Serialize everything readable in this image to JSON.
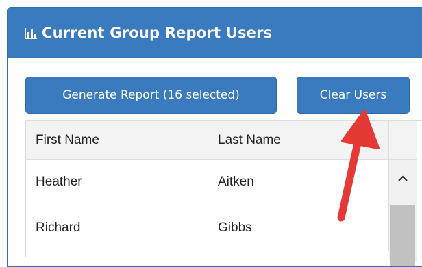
{
  "panel": {
    "title": "Current Group Report Users",
    "icon": "bar-chart-icon"
  },
  "buttons": {
    "generate_label": "Generate Report (16 selected)",
    "clear_label": "Clear Users"
  },
  "table": {
    "headers": [
      "First Name",
      "Last Name"
    ],
    "rows": [
      [
        "Heather",
        "Aitken"
      ],
      [
        "Richard",
        "Gibbs"
      ]
    ]
  },
  "colors": {
    "accent": "#3a7bbf",
    "annotation_arrow": "#e53935"
  },
  "annotation": {
    "icon": "red-arrow-annotation"
  }
}
